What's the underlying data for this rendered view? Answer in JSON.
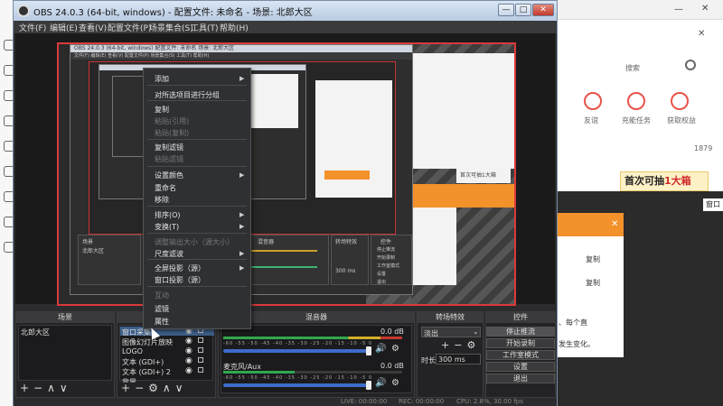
{
  "obs": {
    "title": "OBS 24.0.3 (64-bit, windows) - 配置文件: 未命名 - 场景: 北郎大区",
    "window_buttons": [
      "—",
      "□",
      "✕"
    ],
    "menu": [
      "文件(F)",
      "编辑(E)",
      "查看(V)",
      "配置文件(P)",
      "场景集合(S)",
      "工具(T)",
      "帮助(H)"
    ]
  },
  "nested": {
    "title1": "OBS 24.0.3 (64-bit, windows)   配置文件: 未命名   场景: 北郎大区",
    "menu1": "文件(F)  编辑(E)  查看(V)  配置文件(P)  场景集合(S)  工具(T)  帮助(H)",
    "dock_labels": [
      "场景",
      "北郎大区",
      "混音器",
      "转场特效",
      "控件",
      "停止推流",
      "开始录制",
      "工作室模式",
      "设置",
      "退出"
    ],
    "orange_text": "首次可抽1大箱",
    "time_label": "300 ms"
  },
  "context_menu": {
    "items": [
      {
        "label": "添加",
        "submenu": true,
        "disabled": false
      },
      {
        "label": "对所选项目进行分组",
        "submenu": false,
        "disabled": false
      },
      {
        "label": "复制",
        "submenu": false,
        "disabled": false
      },
      {
        "label": "粘贴(引用)",
        "submenu": false,
        "disabled": true
      },
      {
        "label": "粘贴(复制)",
        "submenu": false,
        "disabled": true
      },
      {
        "label": "复制滤镜",
        "submenu": false,
        "disabled": false
      },
      {
        "label": "粘贴滤镜",
        "submenu": false,
        "disabled": true
      },
      {
        "label": "设置颜色",
        "submenu": true,
        "disabled": false
      },
      {
        "label": "重命名",
        "submenu": false,
        "disabled": false
      },
      {
        "label": "移除",
        "submenu": false,
        "disabled": false
      },
      {
        "label": "排序(O)",
        "submenu": true,
        "disabled": false
      },
      {
        "label": "变换(T)",
        "submenu": true,
        "disabled": false
      },
      {
        "label": "调整输出大小（源大小）",
        "submenu": false,
        "disabled": true
      },
      {
        "label": "尺度滤波",
        "submenu": true,
        "disabled": false
      },
      {
        "label": "全屏投影（源）",
        "submenu": true,
        "disabled": false
      },
      {
        "label": "窗口投影（源）",
        "submenu": false,
        "disabled": false
      },
      {
        "label": "互动",
        "submenu": false,
        "disabled": true
      },
      {
        "label": "滤镜",
        "submenu": false,
        "disabled": false
      },
      {
        "label": "属性",
        "submenu": false,
        "disabled": false
      }
    ]
  },
  "docks": {
    "scenes": {
      "title": "场景",
      "items": [
        "北郎大区"
      ]
    },
    "sources": {
      "title": "来源",
      "items": [
        "窗口采集",
        "图像幻灯片放映",
        "LOGO",
        "文本 (GDI+)",
        "文本 (GDI+) 2",
        "背景"
      ]
    },
    "mixer": {
      "title": "混音器",
      "channels": [
        {
          "name": "",
          "db": "0.0 dB"
        },
        {
          "name": "麦克风/Aux",
          "db": "0.0 dB"
        }
      ],
      "scale": "-60 -55 -50 -45 -40 -35 -30 -25 -20 -15 -10 -5 0"
    },
    "transitions": {
      "title": "转场特效",
      "selected": "淡出",
      "duration_label": "时长",
      "duration": "300 ms"
    },
    "controls": {
      "title": "控件",
      "buttons": [
        "停止推流",
        "开始录制",
        "工作室模式",
        "设置",
        "退出"
      ]
    },
    "foot_symbols": [
      "+",
      "−",
      "∧",
      "∨"
    ],
    "sources_foot": [
      "+",
      "−",
      "⚙",
      "∧",
      "∨"
    ],
    "transition_foot": [
      "+",
      "−",
      "⚙"
    ]
  },
  "status": {
    "live": "LIVE: 00:00:00",
    "rec": "REC: 00:00:00",
    "cpu": "CPU: 2.8%, 30.00 fps"
  },
  "browser": {
    "search_placeholder": "搜索",
    "icons": [
      {
        "label": "友谊"
      },
      {
        "label": "充能任务"
      },
      {
        "label": "获取权益"
      }
    ],
    "count_text": "1879",
    "ticket_text_a": "首次可抽",
    "ticket_text_b": "1大箱",
    "window_label": "窗口",
    "dialog_lines": [
      "复制",
      "复制",
      "、每个直",
      "发生变化。"
    ]
  },
  "colors": {
    "accent": "#f3912a",
    "obs_bg": "#2c2c2e",
    "meter_green": "#2fa84f",
    "preview_border": "#d93a3a"
  }
}
